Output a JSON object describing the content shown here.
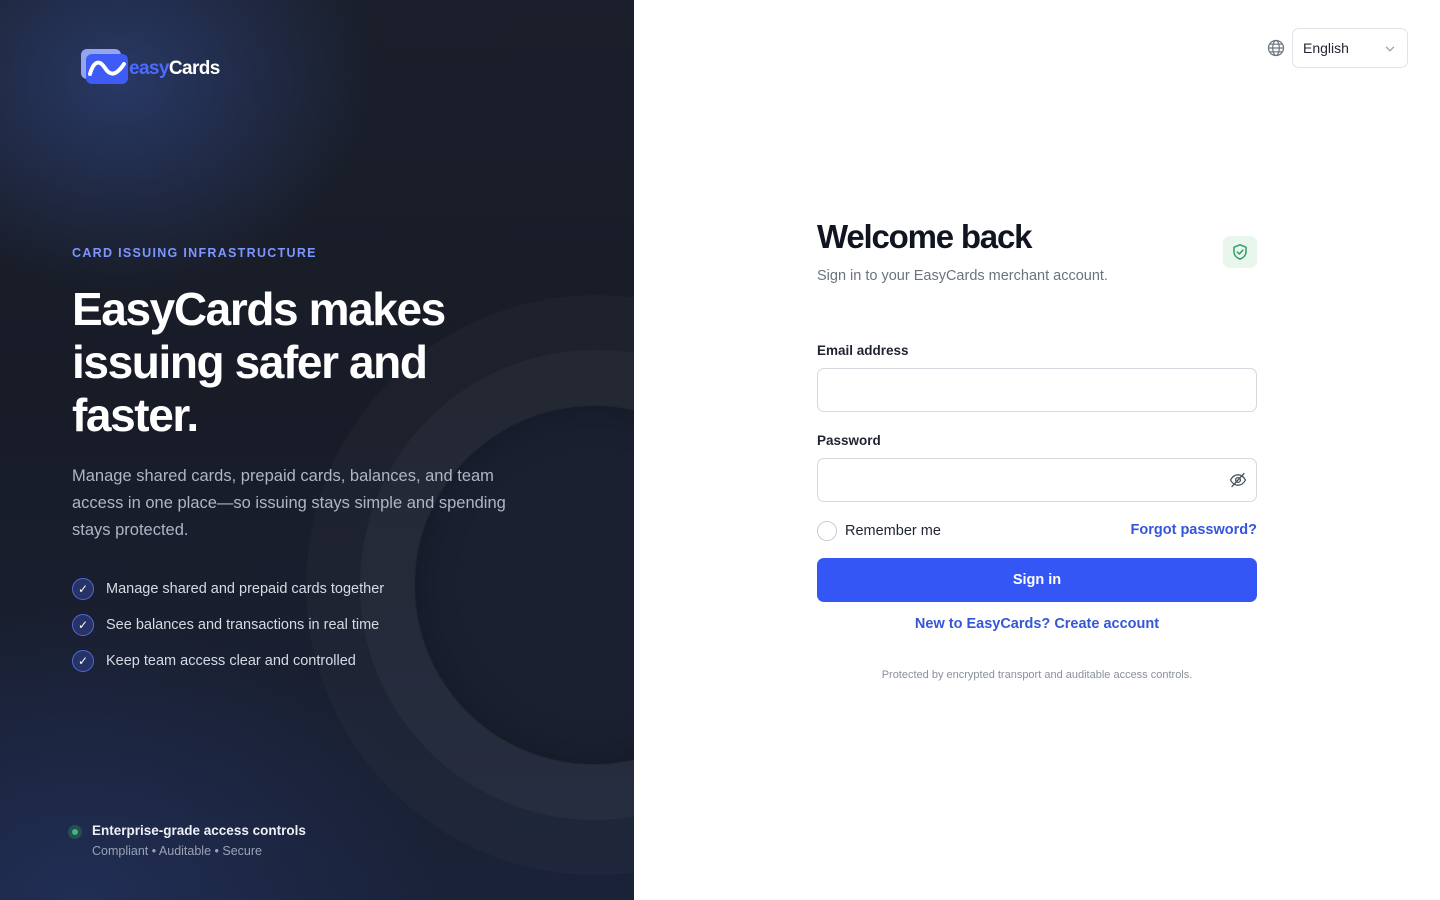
{
  "brand": {
    "logo_text_easy": "easy",
    "logo_text_cards": "Cards",
    "accent": "#3456f5",
    "logo_blue": "#4c6bff"
  },
  "hero": {
    "eyebrow": "CARD ISSUING INFRASTRUCTURE",
    "headline": "EasyCards makes issuing safer and faster.",
    "description": "Manage shared cards, prepaid cards, balances, and team access in one place—so issuing stays simple and spending stays protected.",
    "features": [
      "Manage shared and prepaid cards together",
      "See balances and transactions in real time",
      "Keep team access clear and controlled"
    ],
    "check_glyph": "✓"
  },
  "trust": {
    "title": "Enterprise-grade access controls",
    "subtitle": "Compliant • Auditable • Secure",
    "status_color": "#3dba78"
  },
  "language": {
    "selected": "English",
    "icon": "globe-icon"
  },
  "login": {
    "title": "Welcome back",
    "subtitle": "Sign in to your EasyCards merchant account.",
    "badge_icon": "shield-check-icon",
    "email_label": "Email address",
    "email_value": "",
    "password_label": "Password",
    "password_value": "",
    "password_toggle_icon": "eye-off-icon",
    "remember_label": "Remember me",
    "remember_checked": false,
    "forgot_label": "Forgot password?",
    "submit_label": "Sign in",
    "create_account_label": "New to EasyCards? Create account",
    "fineprint": "Protected by encrypted transport and auditable access controls."
  }
}
